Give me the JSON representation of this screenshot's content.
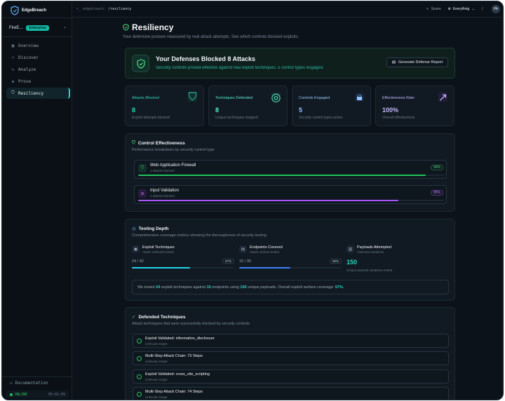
{
  "app": {
    "name": "EdgeBreach"
  },
  "org": {
    "name": "FireE...",
    "plan": "Enterprise"
  },
  "nav": [
    {
      "label": "Overview",
      "icon": "grid-icon"
    },
    {
      "label": "Discover",
      "icon": "search-icon"
    },
    {
      "label": "Analyze",
      "icon": "activity-icon"
    },
    {
      "label": "Prove",
      "icon": "shield-icon"
    },
    {
      "label": "Resiliency",
      "icon": "shield-check-icon"
    }
  ],
  "sidebar_footer": {
    "docs": "Documentation",
    "status": "ONLINE",
    "time": "05:01:09"
  },
  "topbar": {
    "crumb_root": "edgebreach:",
    "crumb_current": "/resiliency",
    "scans": "Scans",
    "scope": "Everything",
    "avatar": "PA"
  },
  "page": {
    "title": "Resiliency",
    "subtitle": "Your defensive posture measured by real attack attempts. See which controls blocked exploits."
  },
  "hero": {
    "title": "Your Defenses Blocked 8 Attacks",
    "subtitle": "Security controls proved effective against real exploit techniques. 5 control types engaged.",
    "button": "Generate Defense Report"
  },
  "stats": [
    {
      "label": "Attacks Blocked",
      "value": "8",
      "desc": "Exploit attempts blocked",
      "color": "#2dd4bf"
    },
    {
      "label": "Techniques Defended",
      "value": "8",
      "desc": "Unique techniques stopped",
      "color": "#5eead4"
    },
    {
      "label": "Controls Engaged",
      "value": "5",
      "desc": "Security control types active",
      "color": "#93c5fd"
    },
    {
      "label": "Effectiveness Rate",
      "value": "100%",
      "desc": "Overall effectiveness",
      "color": "#c4b5fd"
    }
  ],
  "control_effectiveness": {
    "title": "Control Effectiveness",
    "subtitle": "Performance breakdown by security control type",
    "controls": [
      {
        "name": "Web Application Firewall",
        "sub": "1 attacks blocked",
        "pct": "94%",
        "value": 0.94,
        "color": "#22c55e"
      },
      {
        "name": "Input Validation",
        "sub": "1 attacks blocked",
        "pct": "85%",
        "value": 0.85,
        "color": "#a855f7"
      }
    ]
  },
  "testing_depth": {
    "title": "Testing Depth",
    "subtitle": "Comprehensive coverage metrics showing the thoroughness of security testing",
    "exploit": {
      "name": "Exploit Techniques",
      "sub": "Attack methods tested",
      "count": "24 / 42",
      "pct": "57%",
      "value": 0.57
    },
    "endpoints": {
      "name": "Endpoints Covered",
      "sub": "Attack surface tested",
      "count": "15 / 30",
      "pct": "50%",
      "value": 0.5
    },
    "payloads": {
      "name": "Payloads Attempted",
      "sub": "Total test variations",
      "value": "150",
      "desc": "Unique payload variations tested"
    },
    "summary": {
      "a": "We tested ",
      "n1": "24",
      "b": " exploit techniques against ",
      "n2": "15",
      "c": " endpoints using ",
      "n3": "150",
      "d": " unique payloads. Overall exploit surface coverage: ",
      "n4": "57%",
      "e": "."
    }
  },
  "defended": {
    "title": "Defended Techniques",
    "subtitle": "Attack techniques that were successfully blocked by security controls",
    "items": [
      {
        "name": "Exploit Validated: information_disclosure",
        "sub": "Unknown target"
      },
      {
        "name": "Multi-Step Attack Chain: 73 Steps",
        "sub": "Unknown target"
      },
      {
        "name": "Exploit Validated: cross_site_scripting",
        "sub": "Unknown target"
      },
      {
        "name": "Multi-Step Attack Chain: 74 Steps",
        "sub": "Unknown target"
      }
    ]
  }
}
